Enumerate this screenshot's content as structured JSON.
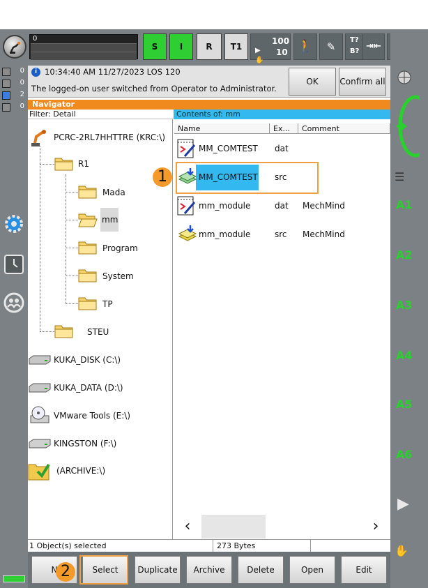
{
  "status_bar": {
    "program_number": "0",
    "tiles": {
      "s": "S",
      "i": "I",
      "r": "R",
      "mode": "T1"
    },
    "override_1": "100",
    "override_2": "10",
    "override_t": "T?",
    "override_b": "B?",
    "infinite": "∞"
  },
  "left_status": [
    {
      "count": "0",
      "color": "#8c8c8c"
    },
    {
      "count": "0",
      "color": "#8c8c8c"
    },
    {
      "count": "2",
      "color": "#3b7de0"
    },
    {
      "count": "0",
      "color": "#8c8c8c"
    }
  ],
  "message": {
    "header": "10:34:40 AM 11/27/2023 LOS 120",
    "text": "The logged-on user switched from Operator to Administrator.",
    "ok_label": "OK",
    "confirm_all_label": "Confirm all"
  },
  "navigator": {
    "title": "Navigator",
    "filter": "Filter: Detail",
    "contents_of": "Contents of: mm",
    "tree": {
      "root": "PCRC-2RL7HHTTRE (KRC:\\)",
      "r1": "R1",
      "mada": "Mada",
      "mm": "mm",
      "program": "Program",
      "system": "System",
      "tp": "TP",
      "steu": "STEU",
      "drives": [
        "KUKA_DISK (C:\\)",
        "KUKA_DATA (D:\\)",
        "VMware Tools (E:\\)",
        "KINGSTON (F:\\)",
        "(ARCHIVE:\\)"
      ]
    },
    "columns": {
      "name": "Name",
      "ext": "Ex...",
      "comment": "Comment"
    },
    "files": [
      {
        "name": "MM_COMTEST",
        "ext": "dat",
        "comment": ""
      },
      {
        "name": "MM_COMTEST",
        "ext": "src",
        "comment": ""
      },
      {
        "name": "mm_module",
        "ext": "dat",
        "comment": "MechMind"
      },
      {
        "name": "mm_module",
        "ext": "src",
        "comment": "MechMind"
      }
    ],
    "scroll_left": "‹",
    "scroll_right": "›"
  },
  "footer": {
    "selected": "1 Object(s) selected",
    "size": "273 Bytes"
  },
  "buttons": {
    "new": "N",
    "select": "Select",
    "duplicate": "Duplicate",
    "archive": "Archive",
    "delete": "Delete",
    "open": "Open",
    "edit": "Edit"
  },
  "right_keys": [
    "A1",
    "A2",
    "A3",
    "A4",
    "A5",
    "A6"
  ],
  "callouts": {
    "one": "1",
    "two": "2"
  },
  "colors": {
    "accent_orange": "#f08a1f",
    "select_blue": "#33b8ef",
    "key_green": "#2ad12e"
  }
}
